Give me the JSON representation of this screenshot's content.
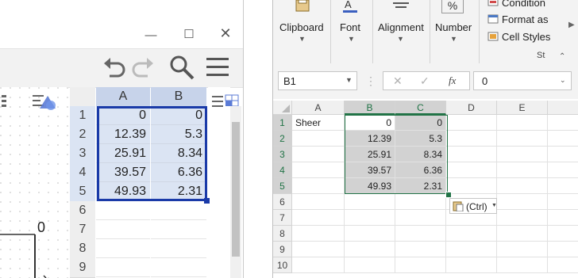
{
  "left": {
    "graph": {
      "point_label": "0"
    },
    "spreadsheet": {
      "columns": [
        "A",
        "B"
      ],
      "rows": [
        {
          "num": "1",
          "a": "0",
          "b": "0"
        },
        {
          "num": "2",
          "a": "12.39",
          "b": "5.3"
        },
        {
          "num": "3",
          "a": "25.91",
          "b": "8.34"
        },
        {
          "num": "4",
          "a": "39.57",
          "b": "6.36"
        },
        {
          "num": "5",
          "a": "49.93",
          "b": "2.31"
        },
        {
          "num": "6",
          "a": "",
          "b": ""
        },
        {
          "num": "7",
          "a": "",
          "b": ""
        },
        {
          "num": "8",
          "a": "",
          "b": ""
        },
        {
          "num": "9",
          "a": "",
          "b": ""
        }
      ]
    }
  },
  "right": {
    "ribbon": {
      "clipboard": "Clipboard",
      "font": "Font",
      "alignment": "Alignment",
      "number": "Number",
      "number_symbol": "%",
      "conditional": "Condition",
      "format_as": "Format as",
      "cell_styles": "Cell Styles",
      "styles_group": "St"
    },
    "formula_bar": {
      "name_box": "B1",
      "fx": "fx",
      "value": "0"
    },
    "columns": [
      "A",
      "B",
      "C",
      "D",
      "E"
    ],
    "rows": [
      {
        "num": "1",
        "a": "Sheer",
        "b": "0",
        "c": "0"
      },
      {
        "num": "2",
        "a": "",
        "b": "12.39",
        "c": "5.3"
      },
      {
        "num": "3",
        "a": "",
        "b": "25.91",
        "c": "8.34"
      },
      {
        "num": "4",
        "a": "",
        "b": "39.57",
        "c": "6.36"
      },
      {
        "num": "5",
        "a": "",
        "b": "49.93",
        "c": "2.31"
      },
      {
        "num": "6",
        "a": "",
        "b": "",
        "c": ""
      },
      {
        "num": "7",
        "a": "",
        "b": "",
        "c": ""
      },
      {
        "num": "8",
        "a": "",
        "b": "",
        "c": ""
      },
      {
        "num": "9",
        "a": "",
        "b": "",
        "c": ""
      },
      {
        "num": "10",
        "a": "",
        "b": "",
        "c": ""
      }
    ],
    "paste_options": "(Ctrl)"
  },
  "colors": {
    "excel_green": "#217346",
    "gg_selection": "#1a3aa8",
    "gg_selection_fill": "#dbe4f3"
  }
}
